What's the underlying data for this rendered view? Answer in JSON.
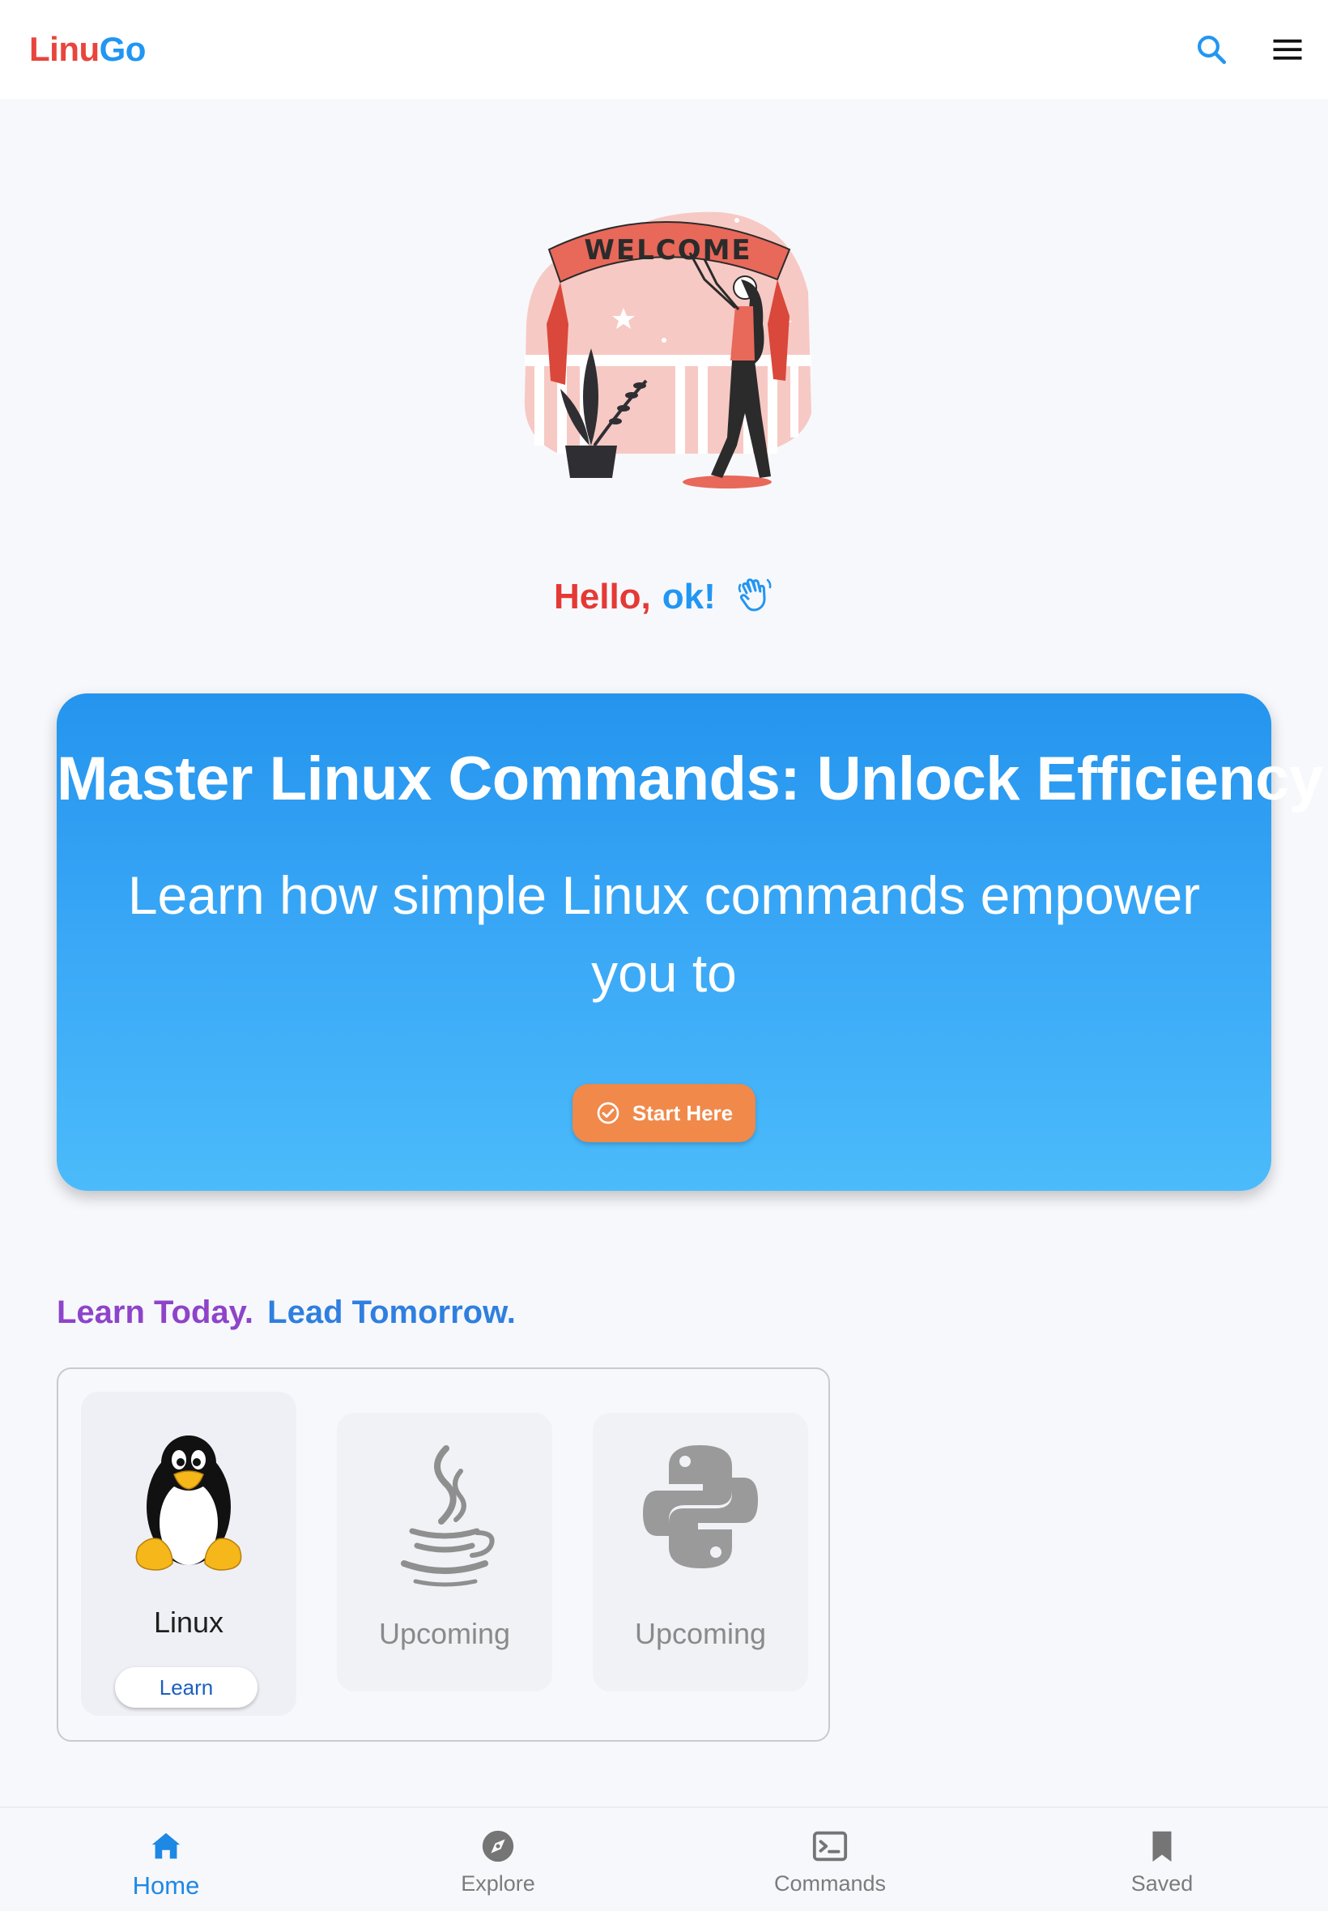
{
  "header": {
    "brand_part1": "Linu",
    "brand_part2": "Go",
    "search_icon": "search-icon",
    "menu_icon": "hamburger-menu-icon"
  },
  "illustration": {
    "banner_text": "WELCOME"
  },
  "greeting": {
    "hello": "Hello,",
    "name": "ok!",
    "icon": "waving-hand-icon"
  },
  "hero": {
    "title": "Master Linux Commands: Unlock Efficiency!",
    "subtitle": "Learn how simple Linux commands empower you to",
    "button_label": "Start Here",
    "button_icon": "check-circle-icon"
  },
  "tagline": {
    "part1": "Learn Today.",
    "part2": "Lead Tomorrow."
  },
  "courses": [
    {
      "name": "Linux",
      "icon": "tux-penguin-icon",
      "button": "Learn"
    },
    {
      "name": "Upcoming",
      "icon": "java-icon"
    },
    {
      "name": "Upcoming",
      "icon": "python-icon"
    }
  ],
  "bottom_nav": [
    {
      "label": "Home",
      "icon": "home-icon",
      "active": true
    },
    {
      "label": "Explore",
      "icon": "compass-icon"
    },
    {
      "label": "Commands",
      "icon": "terminal-icon"
    },
    {
      "label": "Saved",
      "icon": "bookmark-icon"
    }
  ],
  "colors": {
    "brand_red": "#e8453c",
    "brand_blue": "#2196f3",
    "hero_gradient_top": "#2494ee",
    "hero_gradient_bottom": "#4bbbfb",
    "cta_orange": "#f0894a",
    "tagline_purple": "#8e44c9",
    "tagline_blue": "#2f7fe0",
    "nav_active": "#1e88e5"
  }
}
